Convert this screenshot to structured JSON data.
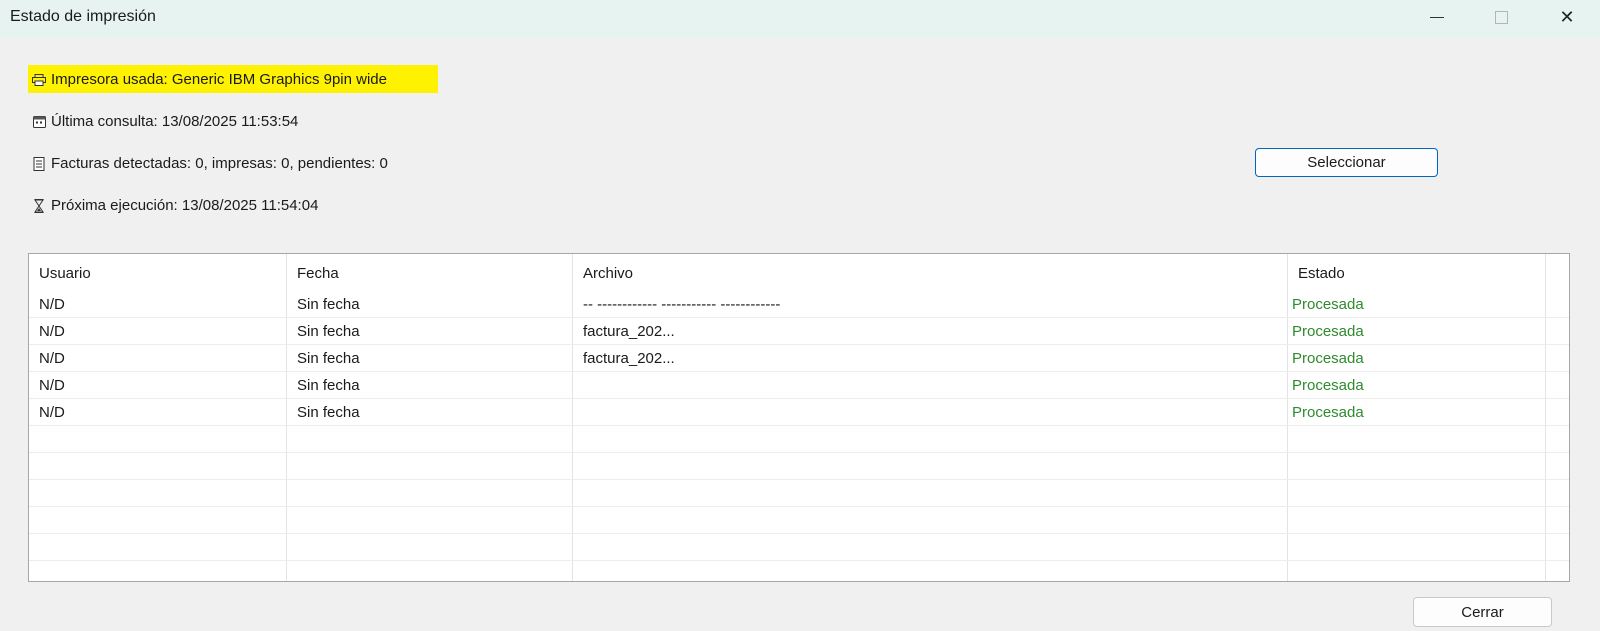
{
  "window": {
    "title": "Estado de impresión",
    "controls": {
      "minimize": "",
      "maximize": "",
      "close": "✕"
    }
  },
  "info": {
    "printer": "Impresora usada: Generic IBM Graphics 9pin wide",
    "last_query": "Última consulta: 13/08/2025 11:53:54",
    "invoices": "Facturas detectadas: 0, impresas: 0, pendientes: 0",
    "next_run": "Próxima ejecución: 13/08/2025 11:54:04"
  },
  "buttons": {
    "select": "Seleccionar",
    "close": "Cerrar"
  },
  "table": {
    "headers": [
      "Usuario",
      "Fecha",
      "Archivo",
      "Estado"
    ],
    "rows": [
      [
        "N/D",
        "Sin fecha",
        "-- ------------ -----------                 ------------",
        "Procesada"
      ],
      [
        "N/D",
        "Sin fecha",
        "factura_202...",
        "Procesada"
      ],
      [
        "N/D",
        "Sin fecha",
        "factura_202...",
        "Procesada"
      ],
      [
        "N/D",
        "Sin fecha",
        "",
        "Procesada"
      ],
      [
        "N/D",
        "Sin fecha",
        "",
        "Procesada"
      ],
      [
        "",
        "",
        "",
        ""
      ],
      [
        "",
        "",
        "",
        ""
      ],
      [
        "",
        "",
        "",
        ""
      ],
      [
        "",
        "",
        "",
        ""
      ],
      [
        "",
        "",
        "",
        ""
      ],
      [
        "",
        "",
        "",
        ""
      ]
    ]
  },
  "colors": {
    "status_text": "#2e8b2e",
    "highlight": "#fff200",
    "titlebar": "#e6f3f1"
  }
}
